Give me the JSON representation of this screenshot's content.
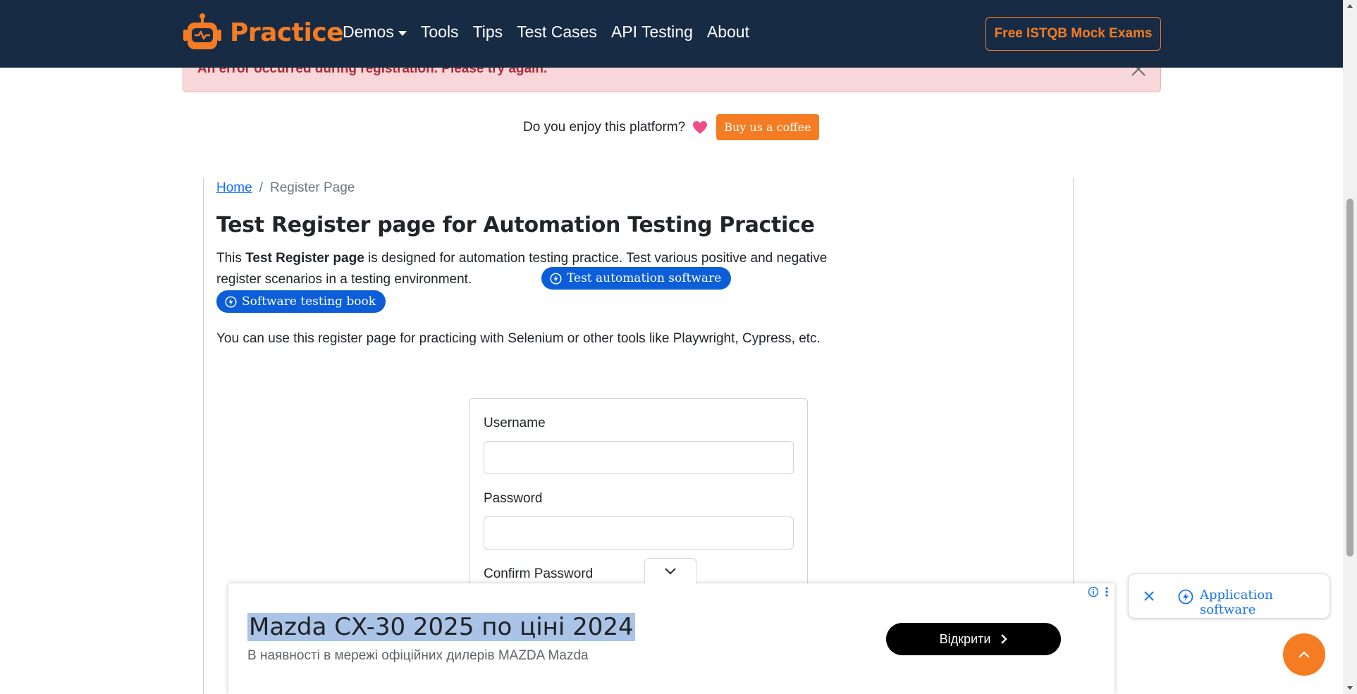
{
  "colors": {
    "navbar_bg": "#172b45",
    "brand_orange": "#f57c22",
    "alert_bg": "#f8d7da",
    "alert_text": "#b02a37",
    "pill_blue": "#0b5ed7",
    "link_blue": "#0d6efd",
    "ad_highlight": "#aac4e8"
  },
  "navbar": {
    "brand": "Practice",
    "brand_icon": "robot-logo-icon",
    "items": [
      {
        "label": "Demos",
        "dropdown": true
      },
      {
        "label": "Tools"
      },
      {
        "label": "Tips"
      },
      {
        "label": "Test Cases"
      },
      {
        "label": "API Testing"
      },
      {
        "label": "About"
      }
    ],
    "cta": "Free ISTQB Mock Exams"
  },
  "alert": {
    "text": "An error occurred during registration. Please try again.",
    "close_icon": "close-icon"
  },
  "coffee": {
    "question": "Do you enjoy this platform?",
    "heart_icon": "heart-icon",
    "button": "Buy us a coffee"
  },
  "breadcrumb": {
    "home": "Home",
    "separator": "/",
    "current": "Register Page"
  },
  "page": {
    "title": "Test Register page for Automation Testing Practice",
    "intro_prefix": "This ",
    "intro_bold": "Test Register page",
    "intro_rest": " is designed for automation testing practice. Test various positive and negative register scenarios in a testing environment.",
    "pill_1": "Test automation software",
    "pill_2": "Software testing book",
    "tools_text": "You can use this register page for practicing with Selenium or other tools like Playwright, Cypress, etc."
  },
  "form": {
    "username_label": "Username",
    "username_value": "",
    "password_label": "Password",
    "password_value": "",
    "confirm_label": "Confirm Password"
  },
  "ad": {
    "title": "Mazda CX-30 2025 по ціні 2024",
    "subtitle": "В наявності в мережі офіційних дилерів MAZDA Mazda",
    "button": "Відкрити"
  },
  "floating": {
    "app_software": "Application software"
  }
}
